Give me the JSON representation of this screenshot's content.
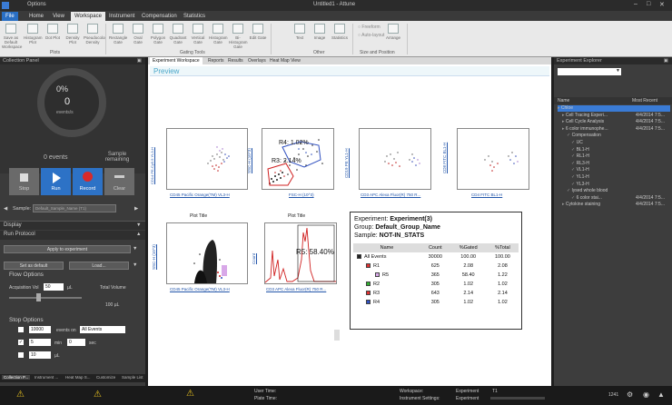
{
  "titlebar": {
    "title": "Untitled1 - Attune",
    "menu": "Options"
  },
  "ribbon_tabs": [
    "File",
    "Home",
    "View",
    "Workspace",
    "Instrument",
    "Compensation",
    "Statistics"
  ],
  "ribbon": {
    "plots": [
      "Save as Default Workspace",
      "Histogram Plot",
      "Dot Plot",
      "Density Plot",
      "Pseudocolor Density"
    ],
    "gating": [
      "Rectangle Gate",
      "Oval Gate",
      "Polygon Gate",
      "Quadrant Gate",
      "Vertical Gate",
      "Histogram Gate",
      "Bi-Histogram Gate",
      "Edit Gate"
    ],
    "other": [
      "Text",
      "Image",
      "Statistics"
    ],
    "size": [
      "Freeform",
      "Auto-layout",
      "Arrange"
    ],
    "groups": [
      "Plots",
      "Gating Tools",
      "Other",
      "Size and Position"
    ]
  },
  "left": {
    "title": "Collection Panel",
    "gauge_pct": "0%",
    "gauge_val": "0",
    "gauge_unit": "events/s",
    "events": "0 events",
    "remaining": "Sample remaining",
    "controls": [
      "Stop",
      "Run",
      "Record",
      "Clear"
    ],
    "sample_label": "Sample:",
    "sample_value": "Default_Sample_Name (T1)",
    "display": "Display",
    "run_protocol": "Run Protocol",
    "apply": "Apply to experiment",
    "set_default": "Set as default",
    "load": "Load...",
    "flow_options": "Flow Options",
    "acq_label": "Acquisition Vol",
    "acq_value": "50",
    "acq_unit": "µL",
    "total_label": "Total Volume",
    "total_value": "100 µL",
    "stop_options": "Stop Options",
    "stop_events": "10000",
    "events_on": "events on",
    "all_events": "All Events",
    "min_val": "5",
    "min_label": "min",
    "sec_val": "0",
    "sec_label": "sec",
    "vol_val": "10",
    "vol_unit": "µL",
    "tabs": [
      "Collection P...",
      "Instrument ...",
      "Heat Map S...",
      "Customize",
      "Sample List"
    ]
  },
  "centre": {
    "tabs": [
      "Experiment Workspace",
      "Reports",
      "Results",
      "Overlays",
      "Heat Map View"
    ],
    "preview": "Preview",
    "plots": [
      {
        "ylabel": "CD14 PE-Cy5.5 YL3-H",
        "xlabel": "CD45 Pacific Orange(TM) VL3-H"
      },
      {
        "ylabel": "SSC-H (10^3)",
        "xlabel": "FSC-H (10^3)",
        "gate1": "R4: 1.02%",
        "gate2": "R3: 2.14%"
      },
      {
        "ylabel": "CD19 PE YL1-H",
        "xlabel": "CD3 APC Alexa Fluor(R) 750 R..."
      },
      {
        "ylabel": "CD8 FITC BL1-H",
        "xlabel": "CD4 FITC BL1-H"
      },
      {
        "title": "Plot Title",
        "ylabel": "SSC-H (10^3)",
        "xlabel": "CD45 Pacific Orange(TM) VL3-H"
      },
      {
        "title": "Plot Title",
        "ylabel": "Count",
        "xlabel": "CD3 APC Alexa Fluor(R) 750 R...",
        "gate": "R5: 58.40%"
      }
    ],
    "stats": {
      "experiment_label": "Experiment:",
      "experiment": "Experiment(3)",
      "group_label": "Group:",
      "group": "Default_Group_Name",
      "sample_label": "Sample:",
      "sample": "NOT-IN_STATS",
      "headers": [
        "Name",
        "Count",
        "%Gated",
        "%Total"
      ],
      "rows": [
        {
          "name": "All Events",
          "count": "30000",
          "gated": "100.00",
          "total": "100.00",
          "color": "#222222",
          "indent": 0
        },
        {
          "name": "R1",
          "count": "625",
          "gated": "2.08",
          "total": "2.08",
          "color": "#e03030",
          "indent": 1
        },
        {
          "name": "R5",
          "count": "365",
          "gated": "58.40",
          "total": "1.22",
          "color": "#d8a8e8",
          "indent": 2
        },
        {
          "name": "R2",
          "count": "305",
          "gated": "1.02",
          "total": "1.02",
          "color": "#30b030",
          "indent": 1
        },
        {
          "name": "R3",
          "count": "643",
          "gated": "2.14",
          "total": "2.14",
          "color": "#e03030",
          "indent": 1
        },
        {
          "name": "R4",
          "count": "305",
          "gated": "1.02",
          "total": "1.02",
          "color": "#3050c0",
          "indent": 1
        }
      ]
    }
  },
  "right": {
    "title": "Experiment Explorer",
    "col_name": "Name",
    "col_recent": "Most Recent",
    "tree": [
      {
        "label": "Chloe",
        "date": "",
        "indent": 0,
        "selected": true
      },
      {
        "label": "Cell Tracing Experi...",
        "date": "4/4/2014 7:5...",
        "indent": 1
      },
      {
        "label": "Cell Cycle Analysis",
        "date": "4/4/2014 7:5...",
        "indent": 1
      },
      {
        "label": "6 color immunophe...",
        "date": "4/4/2014 7:5...",
        "indent": 1
      },
      {
        "label": "Compensation",
        "date": "",
        "indent": 2
      },
      {
        "label": "UC",
        "date": "",
        "indent": 3
      },
      {
        "label": "BL1-H",
        "date": "",
        "indent": 3
      },
      {
        "label": "RL1-H",
        "date": "",
        "indent": 3
      },
      {
        "label": "RL3-H",
        "date": "",
        "indent": 3
      },
      {
        "label": "VL1-H",
        "date": "",
        "indent": 3
      },
      {
        "label": "YL1-H",
        "date": "",
        "indent": 3
      },
      {
        "label": "YL3-H",
        "date": "",
        "indent": 3
      },
      {
        "label": "lysed whole blood",
        "date": "",
        "indent": 2
      },
      {
        "label": "6 color stai...",
        "date": "4/4/2014 7:5...",
        "indent": 3
      },
      {
        "label": "Cytokine staining",
        "date": "4/4/2014 7:5...",
        "indent": 1
      }
    ]
  },
  "status": {
    "user_time": "User Time:",
    "plate_time": "Plate Time:",
    "workspace_label": "Workspace:",
    "workspace": "Experiment",
    "inst_label": "Instrument Settings:",
    "inst": "Experiment",
    "tube": "T1",
    "count": "1241"
  },
  "colors": {
    "accent": "#2a6fc4",
    "selected": "#3a7bd5"
  }
}
